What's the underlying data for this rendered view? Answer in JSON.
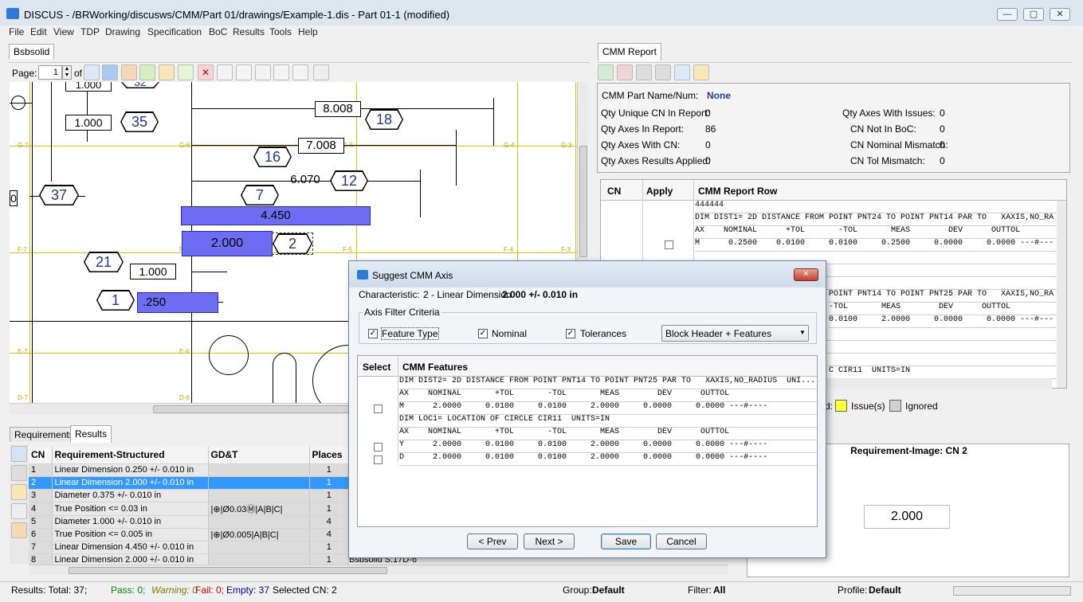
{
  "window": {
    "title": "DISCUS - /BRWorking/discusws/CMM/Part 01/drawings/Example-1.dis - Part 01-1 (modified)",
    "minimize": "—",
    "maximize": "▢",
    "close": "✕"
  },
  "menu": [
    "File",
    "Edit",
    "View",
    "TDP",
    "Drawing",
    "Specification",
    "BoC",
    "Results",
    "Tools",
    "Help"
  ],
  "left_pane": {
    "tab": "Bsbsolid",
    "page_label": "Page:",
    "page_value": "1",
    "page_of": "of 1"
  },
  "drawing": {
    "dims": {
      "d1": "1.000",
      "d2": "1.000",
      "d3": "8.008",
      "d4": "7.008",
      "d5": "6.070",
      "d6": "4.450",
      "d7": "2.000",
      "d8": "1.000",
      "d9": ".250",
      "d10": "0"
    },
    "balloons": {
      "b32": "32",
      "b35": "35",
      "b18": "18",
      "b16": "16",
      "b12": "12",
      "b7": "7",
      "b37": "37",
      "b2": "2",
      "b21": "21",
      "b1": "1"
    },
    "grid": {
      "g7": "G-7",
      "g6": "G-6",
      "g5": "G-5",
      "g4": "G-4",
      "g3": "G-3",
      "f7": "F-7",
      "f6": "F-6",
      "f5": "F-5",
      "f4": "F-4",
      "f3": "F-3",
      "e7": "E-7",
      "e6": "E-6",
      "d7": "D-7",
      "d6": "D-6"
    }
  },
  "cmm_report": {
    "tab": "CMM Report",
    "part_name_label": "CMM Part Name/Num:",
    "part_name_value": "None",
    "stats_left": [
      {
        "label": "Qty Unique CN In Report:",
        "value": "0"
      },
      {
        "label": "Qty Axes In Report:",
        "value": "86"
      },
      {
        "label": "Qty Axes With CN:",
        "value": "0"
      },
      {
        "label": "Qty Axes Results Applied:",
        "value": "0"
      }
    ],
    "stats_right": [
      {
        "label": "Qty Axes With Issues:",
        "value": "0"
      },
      {
        "label": "CN Not In BoC:",
        "value": "0"
      },
      {
        "label": "CN Nominal Mismatch:",
        "value": "0"
      },
      {
        "label": "CN Tol Mismatch:",
        "value": "0"
      }
    ],
    "columns": [
      "CN",
      "Apply",
      "CMM Report Row"
    ],
    "rows": [
      "444444",
      "DIM DIST1= 2D DISTANCE FROM POINT PNT24 TO POINT PNT14 PAR TO   XAXIS,NO_RA",
      "AX    NOMINAL      +TOL       -TOL       MEAS        DEV      OUTTOL",
      "M      0.2500    0.0100     0.0100     0.2500     0.0000     0.0000 ---#---"
    ],
    "rows_lower": [
      "POINT PNT14 TO POINT PNT25 PAR TO   XAXIS,NO_RA",
      "-TOL       MEAS        DEV      OUTTOL",
      "0.0100     2.0000     0.0000     0.0000 ---#---",
      "C CIR11  UNITS=IN"
    ],
    "legend_label": "d:",
    "legend_issue": "Issue(s)",
    "legend_ignored": "Ignored",
    "issue_color": "#ffff33",
    "ignored_color": "#d0d0d0"
  },
  "requirement_image": {
    "title": "Requirement-Image: CN 2",
    "value": "2.000"
  },
  "bottom_tabs": [
    "Requirements",
    "Results"
  ],
  "req_table": {
    "columns": [
      "CN",
      "Requirement-Structured",
      "GD&T",
      "Places"
    ],
    "rows": [
      {
        "cn": "1",
        "req": "Linear Dimension 0.250 +/- 0.010 in",
        "gdt": "",
        "places": "1"
      },
      {
        "cn": "2",
        "req": "Linear Dimension 2.000 +/- 0.010 in",
        "gdt": "",
        "places": "1"
      },
      {
        "cn": "3",
        "req": "Diameter 0.375 +/- 0.010 in",
        "gdt": "",
        "places": "1"
      },
      {
        "cn": "4",
        "req": "True Position <= 0.03 in",
        "gdt": "|⊕|Ø0.03Ⓜ|A|B|C|",
        "places": "1"
      },
      {
        "cn": "5",
        "req": "Diameter 1.000 +/- 0.010 in",
        "gdt": "",
        "places": "4"
      },
      {
        "cn": "6",
        "req": "True Position <= 0.005 in",
        "gdt": "|⊕|Ø0.005|A|B|C|",
        "places": "4"
      },
      {
        "cn": "7",
        "req": "Linear Dimension 4.450 +/- 0.010 in",
        "gdt": "",
        "places": "1"
      },
      {
        "cn": "8",
        "req": "Linear Dimension 2.000 +/- 0.010 in",
        "gdt": "",
        "places": "1"
      }
    ],
    "behind_text": "Bsbsolid S.17D-6"
  },
  "dialog": {
    "title": "Suggest CMM Axis",
    "characteristic_label": "Characteristic:",
    "characteristic_prefix": "2 - Linear Dimension",
    "characteristic_value": "2.000 +/- 0.010 in",
    "filter_group": "Axis Filter Criteria",
    "filter_feature": "Feature Type",
    "filter_nominal": "Nominal",
    "filter_tol": "Tolerances",
    "filter_select": "Block Header + Features",
    "col_select": "Select",
    "col_features": "CMM Features",
    "rows": [
      {
        "check": false,
        "text": "DIM DIST2= 2D DISTANCE FROM POINT PNT14 TO POINT PNT25 PAR TO   XAXIS,NO_RADIUS  UNI..."
      },
      {
        "check": false,
        "text": "AX    NOMINAL       +TOL       -TOL       MEAS        DEV      OUTTOL"
      },
      {
        "check": true,
        "text": "M      2.0000     0.0100     0.0100     2.0000     0.0000     0.0000 ---#----"
      },
      {
        "check": false,
        "text": "DIM LOC1= LOCATION OF CIRCLE CIR11  UNITS=IN"
      },
      {
        "check": false,
        "text": "AX    NOMINAL       +TOL       -TOL       MEAS        DEV      OUTTOL"
      },
      {
        "check": true,
        "text": "Y      2.0000     0.0100     0.0100     2.0000     0.0000     0.0000 ---#----"
      },
      {
        "check": true,
        "text": "D      2.0000     0.0100     0.0100     2.0000     0.0000     0.0000 ---#----"
      }
    ],
    "prev": "< Prev",
    "next": "Next >",
    "save": "Save",
    "cancel": "Cancel"
  },
  "status": {
    "results_total": "Results: Total: 37;",
    "pass": "Pass: 0;",
    "warning": "Warning: 0",
    "fail": "Fail: 0;",
    "empty": "Empty: 37",
    "selected": "Selected CN: 2",
    "group_label": "Group:",
    "group_value": "Default",
    "filter_label": "Filter:",
    "filter_value": "All",
    "profile_label": "Profile:",
    "profile_value": "Default",
    "pass_color": "#008800",
    "warning_color": "#7a7a00",
    "fail_color": "#cc0000",
    "empty_color": "#0000aa"
  }
}
